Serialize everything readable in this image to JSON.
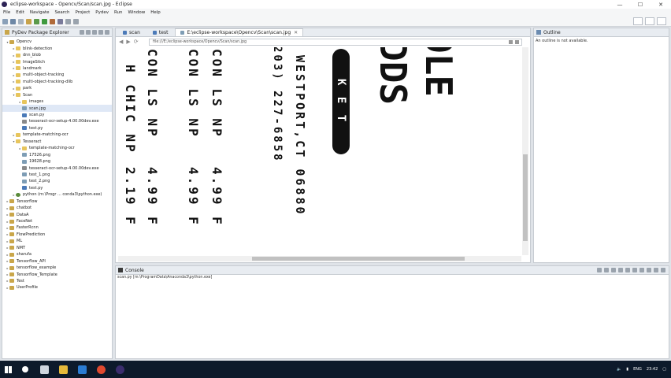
{
  "window": {
    "title": "eclipse-workspace - Opencv/Scan/scan.jpg - Eclipse",
    "controls": [
      "—",
      "☐",
      "✕"
    ]
  },
  "menu": [
    "File",
    "Edit",
    "Navigate",
    "Search",
    "Project",
    "Pydev",
    "Run",
    "Window",
    "Help"
  ],
  "explorer": {
    "title": "PyDev Package Explorer",
    "tree": [
      {
        "label": "Opencv",
        "depth": 0,
        "icon": "project",
        "open": true
      },
      {
        "label": "blink-detection",
        "depth": 1,
        "icon": "folder"
      },
      {
        "label": "dnn_blob",
        "depth": 1,
        "icon": "folder"
      },
      {
        "label": "ImageStich",
        "depth": 1,
        "icon": "folder"
      },
      {
        "label": "landmark",
        "depth": 1,
        "icon": "folder"
      },
      {
        "label": "multi-object-tracking",
        "depth": 1,
        "icon": "folder"
      },
      {
        "label": "multi-object-tracking-dlib",
        "depth": 1,
        "icon": "folder"
      },
      {
        "label": "park",
        "depth": 1,
        "icon": "folder"
      },
      {
        "label": "Scan",
        "depth": 1,
        "icon": "folder",
        "open": true
      },
      {
        "label": "images",
        "depth": 2,
        "icon": "folder"
      },
      {
        "label": "scan.jpg",
        "depth": 2,
        "icon": "img",
        "selected": true
      },
      {
        "label": "scan.py",
        "depth": 2,
        "icon": "py"
      },
      {
        "label": "tesseract-ocr-setup-4.00.00dev.exe",
        "depth": 2,
        "icon": "exe"
      },
      {
        "label": "test.py",
        "depth": 2,
        "icon": "py"
      },
      {
        "label": "template-matching-ocr",
        "depth": 1,
        "icon": "folder"
      },
      {
        "label": "Tesseract",
        "depth": 1,
        "icon": "folder",
        "open": true
      },
      {
        "label": "template-matching-ocr",
        "depth": 2,
        "icon": "folder"
      },
      {
        "label": "17526.png",
        "depth": 2,
        "icon": "img"
      },
      {
        "label": "19628.png",
        "depth": 2,
        "icon": "img"
      },
      {
        "label": "tesseract-ocr-setup-4.00.00dev.exe",
        "depth": 2,
        "icon": "exe"
      },
      {
        "label": "test_1.png",
        "depth": 2,
        "icon": "img"
      },
      {
        "label": "test_2.png",
        "depth": 2,
        "icon": "img"
      },
      {
        "label": "test.py",
        "depth": 2,
        "icon": "py"
      },
      {
        "label": "python (m:\\Progr ... conda3\\python.exe)",
        "depth": 1,
        "icon": "interp"
      },
      {
        "label": "Tensorflow",
        "depth": 0,
        "icon": "project"
      },
      {
        "label": "chatbot",
        "depth": 0,
        "icon": "project"
      },
      {
        "label": "DataA",
        "depth": 0,
        "icon": "project"
      },
      {
        "label": "FaceNet",
        "depth": 0,
        "icon": "project"
      },
      {
        "label": "FasterRcnn",
        "depth": 0,
        "icon": "project"
      },
      {
        "label": "FlowPrediction",
        "depth": 0,
        "icon": "project"
      },
      {
        "label": "ML",
        "depth": 0,
        "icon": "project"
      },
      {
        "label": "NMT",
        "depth": 0,
        "icon": "project"
      },
      {
        "label": "sharufa",
        "depth": 0,
        "icon": "project"
      },
      {
        "label": "Tensorflow_API",
        "depth": 0,
        "icon": "project"
      },
      {
        "label": "tensorflow_example",
        "depth": 0,
        "icon": "project"
      },
      {
        "label": "Tensorflow_Template",
        "depth": 0,
        "icon": "project"
      },
      {
        "label": "Test",
        "depth": 0,
        "icon": "project"
      },
      {
        "label": "UserProfile",
        "depth": 0,
        "icon": "project"
      }
    ]
  },
  "editor": {
    "tabs": [
      {
        "label": "scan",
        "active": false
      },
      {
        "label": "test",
        "active": false
      },
      {
        "label": "E:\\eclipse-workspace\\Opencv\\Scan\\scan.jpg",
        "active": true
      }
    ],
    "url": "file:///E:/eclipse-workspace/Opencv/Scan/scan.jpg",
    "scan_columns": [
      {
        "text": "H CHIC NP",
        "size": 16
      },
      {
        "text": "CON LS NP",
        "size": 16
      },
      {
        "text": "CON LS NP",
        "size": 16
      },
      {
        "text": "CON LS NP",
        "size": 16
      },
      {
        "text": "203) 227-6858",
        "size": 14
      },
      {
        "text": "WESTPORT,CT 06880",
        "size": 15
      },
      {
        "text": "4.99 F",
        "size": 16
      },
      {
        "text": "4.99 F",
        "size": 16
      },
      {
        "text": "4.99 F",
        "size": 16
      },
      {
        "text": "2.19 F",
        "size": 16
      },
      {
        "text": "DDS",
        "size": 46
      },
      {
        "text": "OLE",
        "size": 46
      },
      {
        "text": "K E T",
        "size": 14
      }
    ]
  },
  "outline": {
    "title": "Outline",
    "message": "An outline is not available."
  },
  "console": {
    "title": "Console",
    "process": "scan.py [m:\\ProgramData\\Anaconda3\\python.exe]"
  },
  "taskbar": {
    "tray_lang": "ENG",
    "clock": "23:42"
  }
}
